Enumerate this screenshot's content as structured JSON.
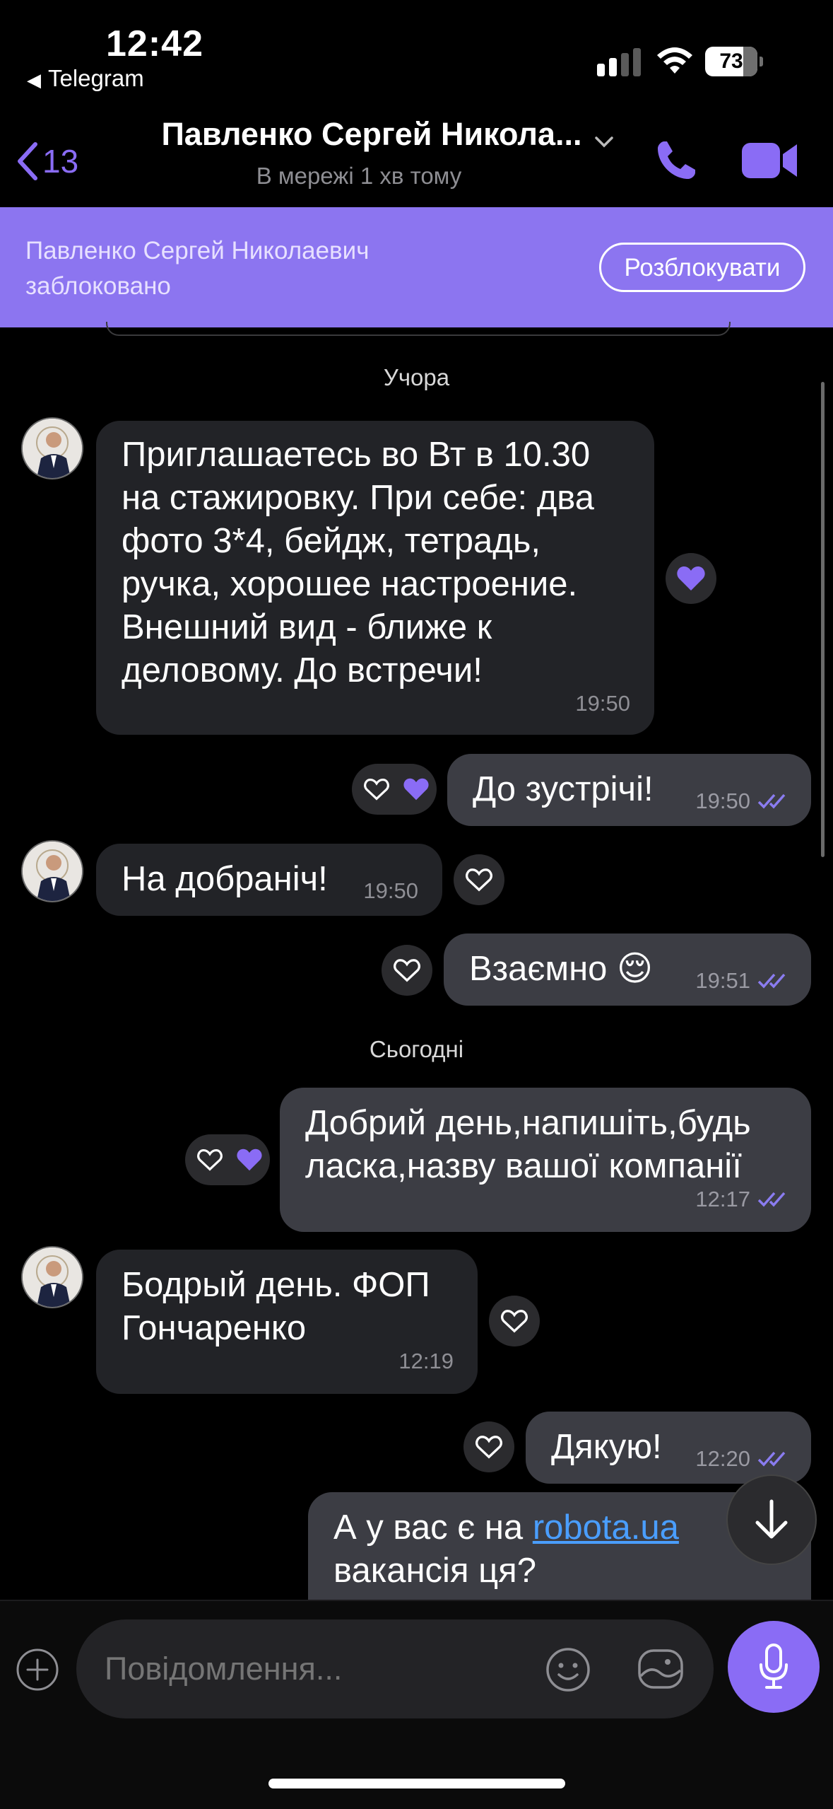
{
  "status_bar": {
    "time": "12:42",
    "back_app": "Telegram",
    "battery": "73",
    "battery_level": 0.73
  },
  "header": {
    "back_count": "13",
    "contact_name": "Павленко Сергей Никола...",
    "presence": "В мережі 1 хв тому"
  },
  "banner": {
    "text": "Павленко Сергей Николаевич заблоковано",
    "unblock_label": "Розблокувати"
  },
  "dates": {
    "yesterday": "Учора",
    "today": "Сьогодні"
  },
  "messages": [
    {
      "dir": "in",
      "text": "Приглашаетесь во Вт в 10.30 на стажировку. При себе: два фото 3*4, бейдж, тетрадь, ручка, хорошее настроение. Внешний вид - ближе к деловому. До встречи!",
      "time": "19:50"
    },
    {
      "dir": "out",
      "text": "До зустрічі!",
      "time": "19:50"
    },
    {
      "dir": "in",
      "text": "На добраніч!",
      "time": "19:50"
    },
    {
      "dir": "out",
      "text": "Взаємно 😌",
      "time": "19:51"
    },
    {
      "dir": "out",
      "text": "Добрий день,напишіть,будь ласка,назву вашої компанії",
      "time": "12:17"
    },
    {
      "dir": "in",
      "text": "Бодрый день. ФОП Гончаренко",
      "time": "12:19"
    },
    {
      "dir": "out",
      "text": "Дякую!",
      "time": "12:20"
    },
    {
      "dir": "out",
      "text_before": "А у вас є на ",
      "link": "robota.ua",
      "text_after": "вакансія ця?"
    }
  ],
  "composer": {
    "placeholder": "Повідомлення..."
  },
  "colors": {
    "accent": "#8a6cf5",
    "banner": "#8c75f0",
    "incoming": "#222327",
    "outgoing": "#3c3d44",
    "link": "#4a9eff"
  }
}
